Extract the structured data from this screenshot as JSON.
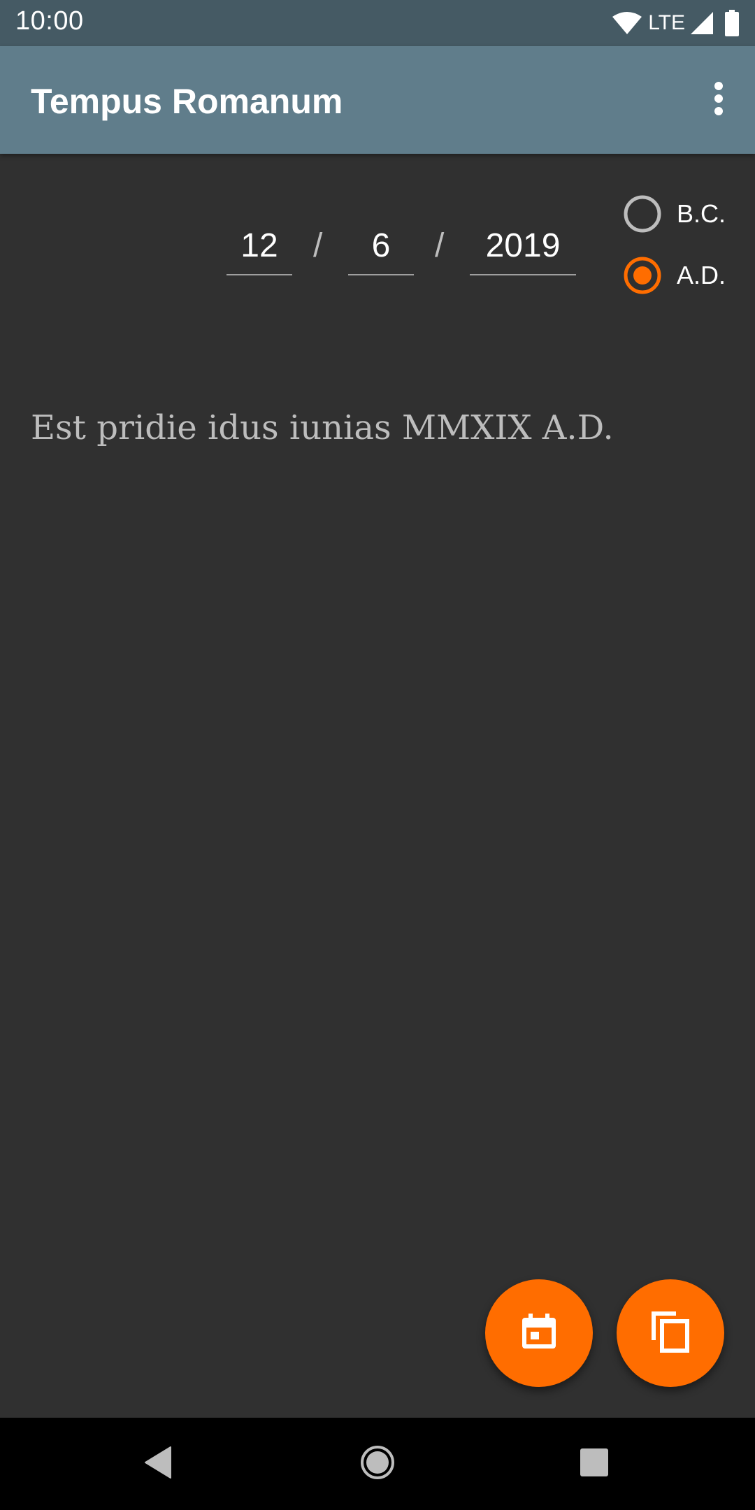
{
  "status_bar": {
    "time": "10:00",
    "network": "LTE",
    "icons": [
      "wifi-icon",
      "signal-icon",
      "battery-icon"
    ]
  },
  "app_bar": {
    "title": "Tempus Romanum",
    "menu_icon": "overflow-menu-icon"
  },
  "date_input": {
    "day": "12",
    "month": "6",
    "year": "2019",
    "separator": "/"
  },
  "era": {
    "options": [
      {
        "label": "B.C.",
        "selected": false
      },
      {
        "label": "A.D.",
        "selected": true
      }
    ]
  },
  "result": {
    "text": "Est pridie idus iunias MMXIX A.D."
  },
  "fabs": {
    "calendar_icon": "calendar-icon",
    "copy_icon": "copy-icon"
  },
  "nav_bar": {
    "icons": [
      "back-icon",
      "home-icon",
      "recents-icon"
    ]
  },
  "colors": {
    "accent": "#ff6d00",
    "app_bar": "#607d8b",
    "status_bar": "#455a64",
    "background": "#303030"
  }
}
